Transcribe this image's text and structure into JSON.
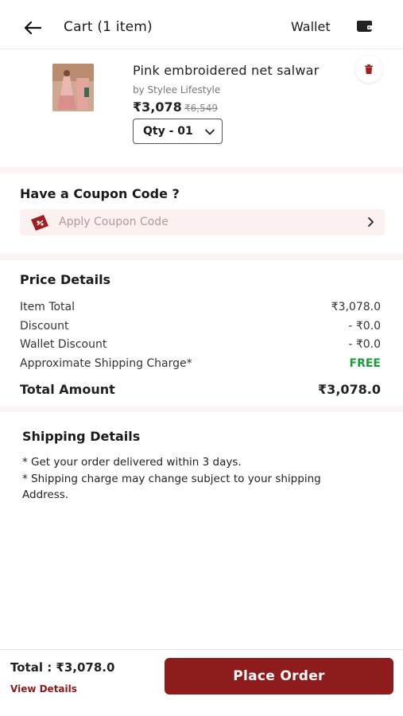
{
  "header": {
    "back_icon": "arrow-left-icon",
    "title": "Cart (1 item)",
    "wallet_label": "Wallet",
    "wallet_icon": "wallet-icon"
  },
  "cart_item": {
    "name": "Pink embroidered net salwar",
    "brand": "by Stylee Lifestyle",
    "price": "₹3,078",
    "mrp": "₹6,549",
    "quantity": "Qty - 01",
    "delete_icon": "trash-icon"
  },
  "coupon": {
    "title": "Have a Coupon Code ?",
    "apply_label": "Apply Coupon Code",
    "icon": "coupon-tag-icon"
  },
  "price_details": {
    "title": "Price Details",
    "rows": [
      {
        "label": "Item Total",
        "value": "₹3,078.0"
      },
      {
        "label": "Discount",
        "value": "- ₹0.0"
      },
      {
        "label": "Wallet Discount",
        "value": "- ₹0.0"
      },
      {
        "label": "Approximate Shipping Charge*",
        "value": "FREE"
      }
    ],
    "total_label": "Total Amount",
    "total_value": "₹3,078.0"
  },
  "shipping": {
    "title": "Shipping Details",
    "notes": [
      "* Get your order delivered within 3 days.",
      "* Shipping charge may change subject to your shipping Address."
    ]
  },
  "footer": {
    "total": "Total : ₹3,078.0",
    "view_details": "View Details",
    "place_order": "Place Order"
  },
  "colors": {
    "brand": "#8f1c1c",
    "free_text": "#1e9b3c",
    "section_bg": "#fcf3f3"
  }
}
